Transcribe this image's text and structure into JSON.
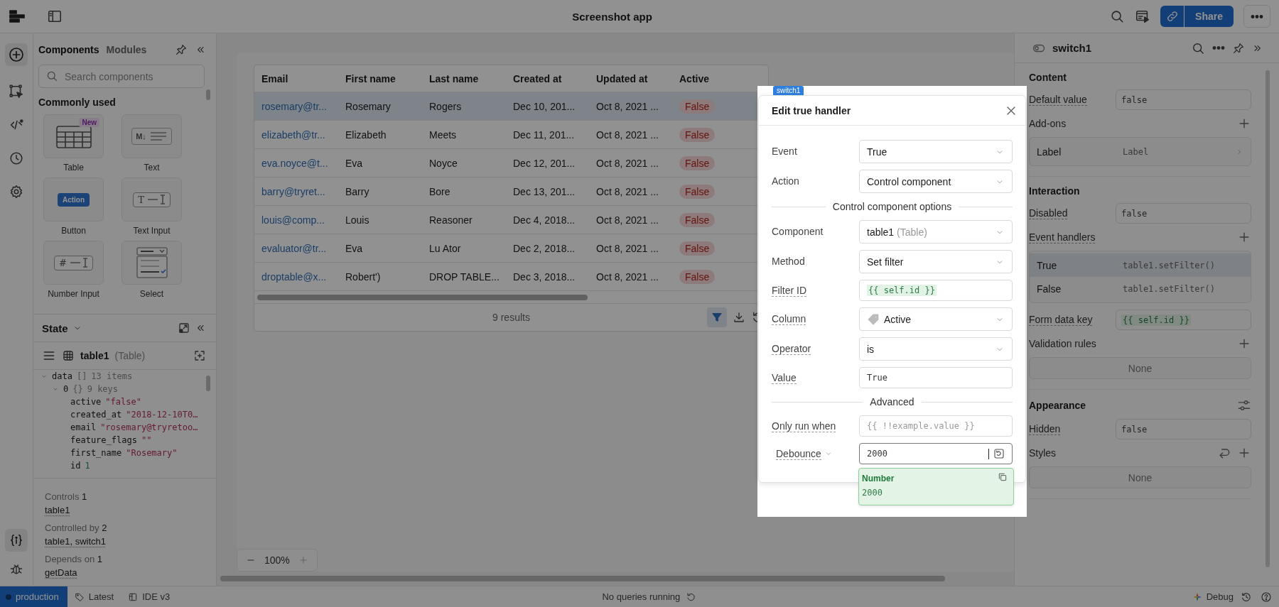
{
  "topbar": {
    "title": "Screenshot app",
    "share": "Share"
  },
  "components_panel": {
    "tabs": [
      {
        "label": "Components",
        "selected": true
      },
      {
        "label": "Modules",
        "selected": false
      }
    ],
    "search": {
      "placeholder": "Search components"
    },
    "section": "Commonly used",
    "tiles": [
      {
        "label": "Table",
        "kind": "table",
        "badge": "New"
      },
      {
        "label": "Text",
        "kind": "text",
        "glyph": "M↓"
      },
      {
        "label": "Button",
        "kind": "button",
        "glyph": "Action"
      },
      {
        "label": "Text Input",
        "kind": "input",
        "glyph": "T"
      },
      {
        "label": "Number Input",
        "kind": "input",
        "glyph": "#"
      },
      {
        "label": "Select",
        "kind": "select"
      }
    ]
  },
  "state_panel": {
    "title": "State",
    "component": "table1",
    "component_type": "(Table)",
    "tree": [
      {
        "key": "data",
        "type": "[]",
        "summary": "13 items",
        "expanded": true,
        "children": [
          {
            "key": "0",
            "type": "{}",
            "summary": "9 keys",
            "expanded": true,
            "children": [
              {
                "key": "active",
                "value": "\"false\"",
                "kind": "string"
              },
              {
                "key": "created_at",
                "value": "\"2018-12-10T0…",
                "kind": "string"
              },
              {
                "key": "email",
                "value": "\"rosemary@tryretoo…",
                "kind": "string"
              },
              {
                "key": "feature_flags",
                "value": "\"\"",
                "kind": "string"
              },
              {
                "key": "first_name",
                "value": "\"Rosemary\"",
                "kind": "string"
              },
              {
                "key": "id",
                "value": "1",
                "kind": "number"
              }
            ]
          }
        ]
      }
    ]
  },
  "dependencies": [
    {
      "label": "Controls",
      "count": "1",
      "value": "table1"
    },
    {
      "label": "Controlled by",
      "count": "2",
      "value": "table1, switch1"
    },
    {
      "label": "Depends on",
      "count": "1",
      "value": "getData"
    }
  ],
  "table": {
    "columns": [
      "Email",
      "First name",
      "Last name",
      "Created at",
      "Updated at",
      "Active"
    ],
    "rows": [
      {
        "cells": [
          "rosemary@tr...",
          "Rosemary",
          "Rogers",
          "Dec 10, 201...",
          "Oct 8, 2021 ...",
          "False"
        ],
        "selected": true
      },
      {
        "cells": [
          "elizabeth@tr...",
          "Elizabeth",
          "Meets",
          "Dec 11, 201...",
          "Oct 8, 2021 ...",
          "False"
        ],
        "selected": false
      },
      {
        "cells": [
          "eva.noyce@t...",
          "Eva",
          "Noyce",
          "Dec 12, 201...",
          "Oct 8, 2021 ...",
          "False"
        ],
        "selected": false
      },
      {
        "cells": [
          "barry@tryret...",
          "Barry",
          "Bore",
          "Dec 13, 201...",
          "Oct 8, 2021 ...",
          "False"
        ],
        "selected": false
      },
      {
        "cells": [
          "louis@comp...",
          "Louis",
          "Reasoner",
          "Dec 4, 2018...",
          "Oct 8, 2021 ...",
          "False"
        ],
        "selected": false
      },
      {
        "cells": [
          "evaluator@tr...",
          "Eva",
          "Lu Ator",
          "Dec 2, 2018...",
          "Oct 8, 2021 ...",
          "False"
        ],
        "selected": false
      },
      {
        "cells": [
          "droptable@x...",
          "Robert')",
          "DROP TABLE...",
          "Dec 3, 2018...",
          "Oct 8, 2021 ...",
          "False"
        ],
        "selected": false
      }
    ],
    "footer": "9 results"
  },
  "zoom": "100%",
  "canvas_tag": "switch1",
  "dialog": {
    "title": "Edit true handler",
    "rows": [
      {
        "kind": "select",
        "label": "Event",
        "value": "True",
        "tooltip": false
      },
      {
        "kind": "select",
        "label": "Action",
        "value": "Control component",
        "tooltip": false
      },
      {
        "kind": "divider",
        "label": "Control component options"
      },
      {
        "kind": "select",
        "label": "Component",
        "value": "table1",
        "hint": "(Table)",
        "tooltip": false
      },
      {
        "kind": "select",
        "label": "Method",
        "value": "Set filter",
        "tooltip": false
      },
      {
        "kind": "code",
        "label": "Filter ID",
        "value": "{{ self.id }}",
        "tooltip": true
      },
      {
        "kind": "tag_select",
        "label": "Column",
        "value": "Active",
        "tooltip": true
      },
      {
        "kind": "select",
        "label": "Operator",
        "value": "is",
        "tooltip": true
      },
      {
        "kind": "input",
        "label": "Value",
        "value": "True",
        "tooltip": true
      },
      {
        "kind": "divider",
        "label": "Advanced"
      },
      {
        "kind": "input",
        "label": "Only run when",
        "placeholder": "{{ !!example.value }}",
        "tooltip": true
      },
      {
        "kind": "dropdown_input",
        "label": "Debounce",
        "value": "2000",
        "tooltip": true,
        "focused": true
      }
    ],
    "popup": {
      "type": "Number",
      "value": "2000"
    }
  },
  "inspector": {
    "title": "switch1",
    "sections": [
      {
        "title": "Content",
        "rows": [
          {
            "kind": "field",
            "label": "Default value",
            "value": "false",
            "tooltip": true
          },
          {
            "kind": "header",
            "label": "Add-ons",
            "tooltip": false,
            "add_button": true
          },
          {
            "kind": "list",
            "items": [
              {
                "kind": "addon",
                "label": "Label",
                "value": "Label",
                "selected": false
              }
            ]
          }
        ]
      },
      {
        "title": "Interaction",
        "rows": [
          {
            "kind": "field",
            "label": "Disabled",
            "value": "false",
            "tooltip": true
          },
          {
            "kind": "header",
            "label": "Event handlers",
            "tooltip": true,
            "add_button": true
          },
          {
            "kind": "list",
            "items": [
              {
                "kind": "handler",
                "label": "True",
                "value": "table1.setFilter()",
                "selected": true
              },
              {
                "kind": "handler",
                "label": "False",
                "value": "table1.setFilter()",
                "selected": false
              }
            ]
          },
          {
            "kind": "code",
            "label": "Form data key",
            "value": "{{ self.id }}",
            "tooltip": true
          },
          {
            "kind": "header",
            "label": "Validation rules",
            "tooltip": false,
            "add_button": true
          },
          {
            "kind": "empty",
            "label": "None"
          }
        ]
      },
      {
        "title": "Appearance",
        "settings_button": true,
        "rows": [
          {
            "kind": "field",
            "label": "Hidden",
            "value": "false",
            "tooltip": true
          },
          {
            "kind": "header",
            "label": "Styles",
            "tooltip": false,
            "reset_button": true,
            "add_button": true
          },
          {
            "kind": "empty",
            "label": "None"
          }
        ]
      }
    ]
  },
  "status_bar": {
    "environment": "production",
    "branch": "Latest",
    "ide": "IDE v3",
    "queries": "No queries running",
    "debug": "Debug"
  }
}
